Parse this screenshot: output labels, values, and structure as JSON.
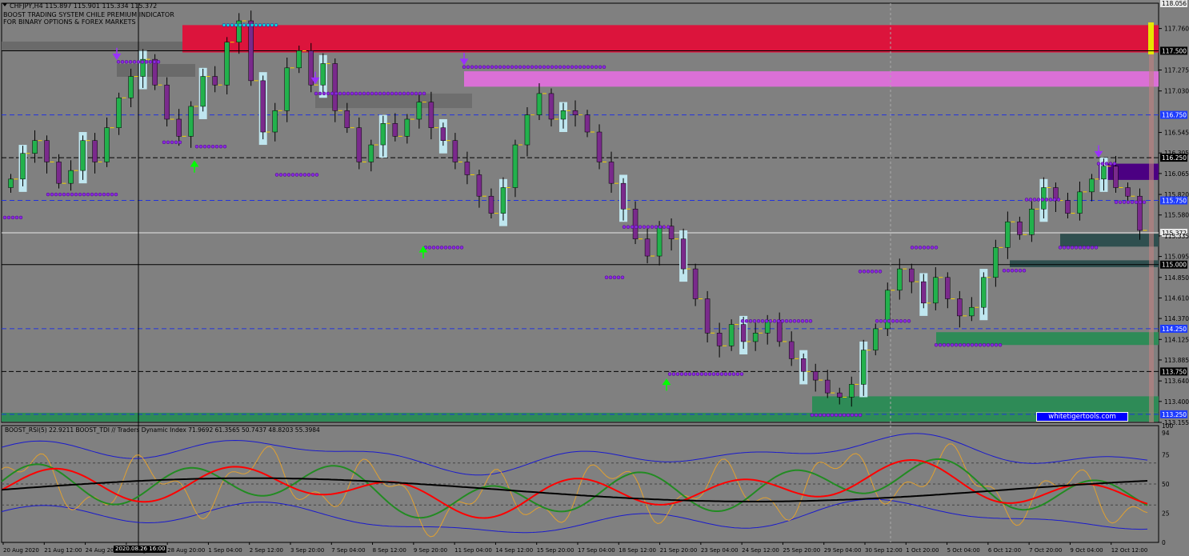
{
  "header": {
    "symbol_line": "CHFJPY,H4  115.897 115.901 115.334 115.372",
    "title_line1": "BOOST TRADING SYSTEM CHILE PREMIUM INDICATOR",
    "title_line2": "FOR BINARY OPTIONS & FOREX MARKETS"
  },
  "indicator_header": "BOOST_RSI(5) 22.9211  BOOST_TDI // Traders Dynamic Index 71.9692 61.3565 50.7437 48.8203 55.3984",
  "watermark": "whitetigertools.com",
  "timestamp_marker": "2020.08.26 16:00",
  "colors": {
    "background": "#808080",
    "bull_candle": "#22b14c",
    "bear_candle": "#7a2a8c",
    "resistance_zone": "#dc143c",
    "pink_zone": "#da70d6",
    "gray_zone": "#6e6e6e",
    "support_zone": "#2e8b57",
    "dark_teal_zone": "#2f4f4f",
    "purple_zone": "#4b0082",
    "dashed_blue": "#2233dd",
    "tdi_red": "#ff0000",
    "tdi_green": "#228b22",
    "tdi_black": "#000000",
    "tdi_blue": "#1a1acc",
    "rsi_orange": "#e0a030"
  },
  "price_axis": {
    "labels": [
      "118.056",
      "117.760",
      "117.500",
      "117.275",
      "117.030",
      "116.750",
      "116.545",
      "116.305",
      "116.250",
      "116.065",
      "115.820",
      "115.750",
      "115.580",
      "115.372",
      "115.335",
      "115.095",
      "115.000",
      "114.850",
      "114.610",
      "114.370",
      "114.250",
      "114.125",
      "113.885",
      "113.750",
      "113.640",
      "113.400",
      "113.250",
      "113.155"
    ],
    "highlighted": {
      "117.500": "black",
      "116.750": "blue",
      "116.250": "black",
      "115.750": "blue",
      "115.372": "white",
      "115.000": "black",
      "114.250": "blue",
      "113.750": "black",
      "113.250": "blue",
      "118.056": "white"
    }
  },
  "indicator_axis": {
    "labels": [
      "100",
      "94",
      "75",
      "50",
      "25",
      "0"
    ]
  },
  "time_axis": {
    "labels": [
      "20 Aug 2020",
      "21 Aug 12:00",
      "24 Aug 20:00",
      "27 Aug 12:00",
      "28 Aug 20:00",
      "1 Sep 04:00",
      "2 Sep 12:00",
      "3 Sep 20:00",
      "7 Sep 04:00",
      "8 Sep 12:00",
      "9 Sep 20:00",
      "11 Sep 04:00",
      "14 Sep 12:00",
      "15 Sep 20:00",
      "17 Sep 04:00",
      "18 Sep 12:00",
      "21 Sep 20:00",
      "23 Sep 04:00",
      "24 Sep 12:00",
      "25 Sep 20:00",
      "29 Sep 04:00",
      "30 Sep 12:00",
      "1 Oct 20:00",
      "5 Oct 04:00",
      "6 Oct 12:00",
      "7 Oct 20:00",
      "9 Oct 04:00",
      "12 Oct 12:00"
    ]
  },
  "chart_data": {
    "type": "candlestick",
    "symbol": "CHFJPY",
    "timeframe": "H4",
    "last_price": 115.372,
    "ylim": [
      113.155,
      118.056
    ],
    "levels": {
      "black": [
        117.5,
        116.25,
        115.0,
        113.75
      ],
      "blue_dashed": [
        116.75,
        115.75,
        114.25,
        113.25
      ]
    },
    "zones": [
      {
        "name": "resistance",
        "top": 117.8,
        "bottom": 117.48
      },
      {
        "name": "pink",
        "top": 117.26,
        "bottom": 117.08
      },
      {
        "name": "gray",
        "top": 117.0,
        "bottom": 116.83
      },
      {
        "name": "purple",
        "top": 116.18,
        "bottom": 115.99
      },
      {
        "name": "dark_teal_1",
        "top": 115.36,
        "bottom": 115.21
      },
      {
        "name": "dark_teal_2",
        "top": 115.05,
        "bottom": 114.97
      },
      {
        "name": "support_1",
        "top": 114.21,
        "bottom": 114.06
      },
      {
        "name": "support_2",
        "top": 113.46,
        "bottom": 113.27
      }
    ],
    "close": [
      116.0,
      116.3,
      116.45,
      116.2,
      115.95,
      116.1,
      116.45,
      116.2,
      116.6,
      116.95,
      117.2,
      117.4,
      117.1,
      116.7,
      116.5,
      116.85,
      117.2,
      117.1,
      117.6,
      117.85,
      117.15,
      116.55,
      116.8,
      117.3,
      117.5,
      117.1,
      117.35,
      116.8,
      116.6,
      116.2,
      116.4,
      116.65,
      116.5,
      116.7,
      116.9,
      116.6,
      116.45,
      116.2,
      116.05,
      115.8,
      115.6,
      115.9,
      116.4,
      116.75,
      117.0,
      116.7,
      116.8,
      116.75,
      116.55,
      116.2,
      115.95,
      115.65,
      115.3,
      115.1,
      115.45,
      115.3,
      114.95,
      114.6,
      114.2,
      114.05,
      114.3,
      114.1,
      114.2,
      114.35,
      114.1,
      113.9,
      113.75,
      113.65,
      113.5,
      113.45,
      113.6,
      114.0,
      114.25,
      114.7,
      114.95,
      114.8,
      114.55,
      114.85,
      114.6,
      114.4,
      114.5,
      114.85,
      115.2,
      115.5,
      115.35,
      115.65,
      115.9,
      115.75,
      115.6,
      115.85,
      116.0,
      116.15,
      115.9,
      115.8,
      115.4
    ]
  }
}
